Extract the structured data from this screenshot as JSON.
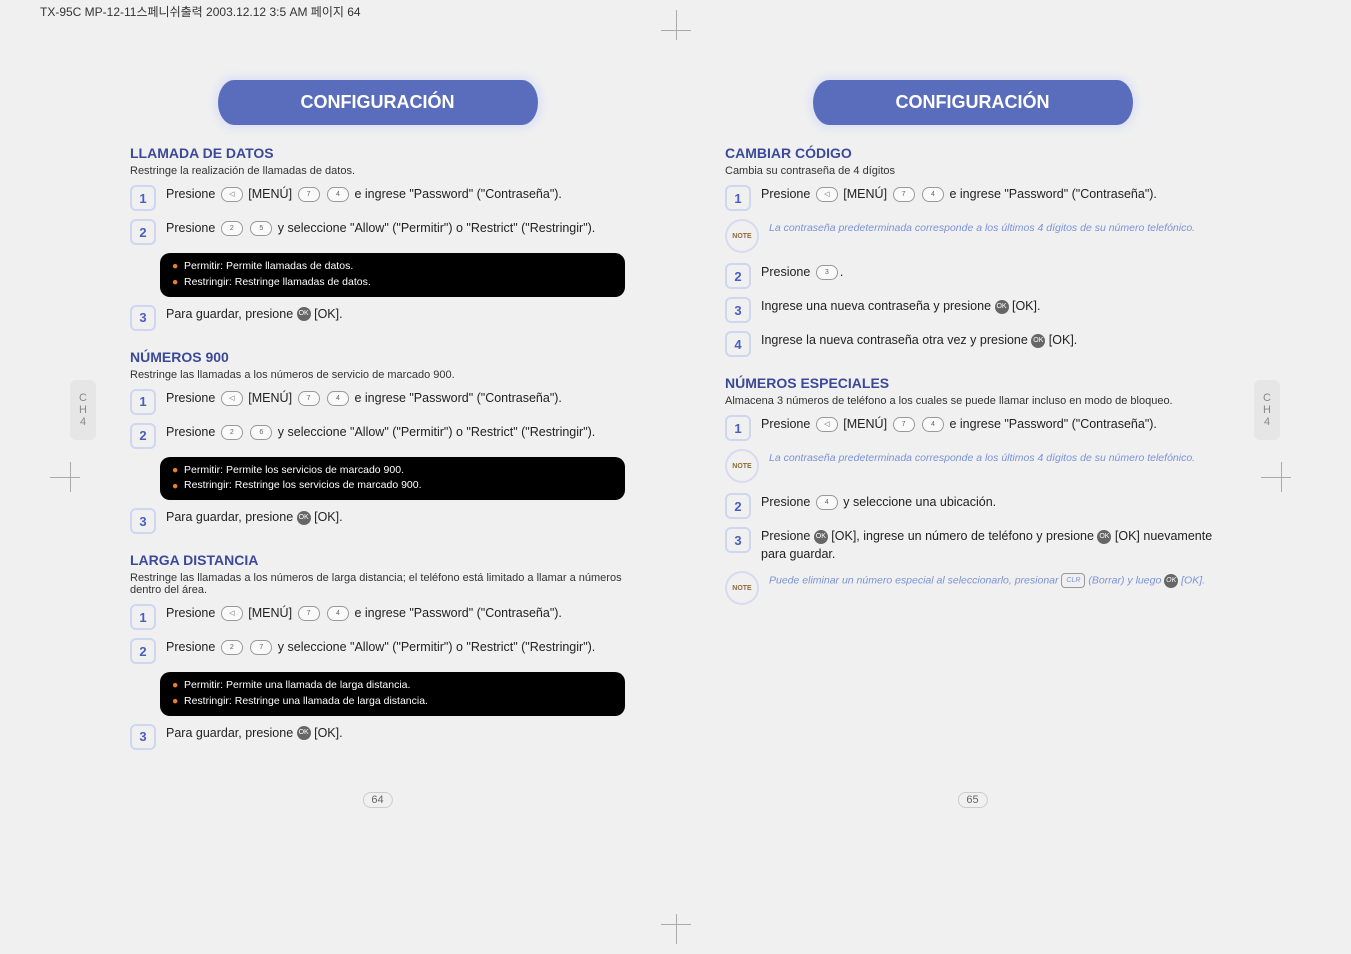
{
  "meta": {
    "header_strip": "TX-95C MP-12-11스페니쉬출력  2003.12.12 3:5 AM  페이지 64"
  },
  "shared": {
    "banner_title": "CONFIGURACIÓN",
    "note_label": "NOTE",
    "chapter_tab": "CH\n4",
    "press_menu_password": "Presione        [MENÚ]                 e ingrese \"Password\" (\"Contraseña\").",
    "default_pw_note": "La contraseña predeterminada corresponde a los últimos 4 dígitos de su número telefónico.",
    "save_ok": "Para guardar, presione        [OK]."
  },
  "left_page": {
    "number": "64",
    "sections": {
      "data_call": {
        "title": "LLAMADA DE DATOS",
        "intro": "Restringe la realización de llamadas de datos.",
        "step2": "Presione                 y seleccione \"Allow\" (\"Permitir\") o \"Restrict\" (\"Restringir\").",
        "box_a": "Permitir: Permite llamadas de datos.",
        "box_b": "Restringir: Restringe llamadas de datos."
      },
      "nine_hundred": {
        "title": "NÚMEROS 900",
        "intro": "Restringe las llamadas a los números de servicio de marcado 900.",
        "step2": "Presione                 y seleccione \"Allow\" (\"Permitir\") o \"Restrict\" (\"Restringir\").",
        "box_a": "Permitir: Permite los servicios de marcado 900.",
        "box_b": "Restringir: Restringe los servicios de marcado 900."
      },
      "long_distance": {
        "title": "LARGA DISTANCIA",
        "intro": "Restringe las llamadas a los números de larga distancia; el teléfono está limitado a llamar a números dentro del área.",
        "step2": "Presione                 y seleccione \"Allow\" (\"Permitir\") o \"Restrict\" (\"Restringir\").",
        "box_a": "Permitir: Permite una llamada de larga distancia.",
        "box_b": "Restringir: Restringe una llamada de larga distancia."
      }
    }
  },
  "right_page": {
    "number": "65",
    "sections": {
      "change_code": {
        "title": "CAMBIAR CÓDIGO",
        "intro": "Cambia su contraseña de 4 dígitos",
        "step2": "Presione        .",
        "step3": "Ingrese una nueva contraseña y presione        [OK].",
        "step4": "Ingrese la nueva contraseña otra vez y presione        [OK]."
      },
      "special_numbers": {
        "title": "NÚMEROS ESPECIALES",
        "intro": "Almacena 3 números de teléfono a los cuales se puede llamar incluso en modo de bloqueo.",
        "step2": "Presione          y seleccione una ubicación.",
        "step3": "Presione        [OK], ingrese un número de teléfono y presione        [OK] nuevamente para guardar.",
        "note2": "Puede eliminar un número especial al seleccionarlo, presionar        (Borrar) y luego        [OK]."
      }
    }
  }
}
